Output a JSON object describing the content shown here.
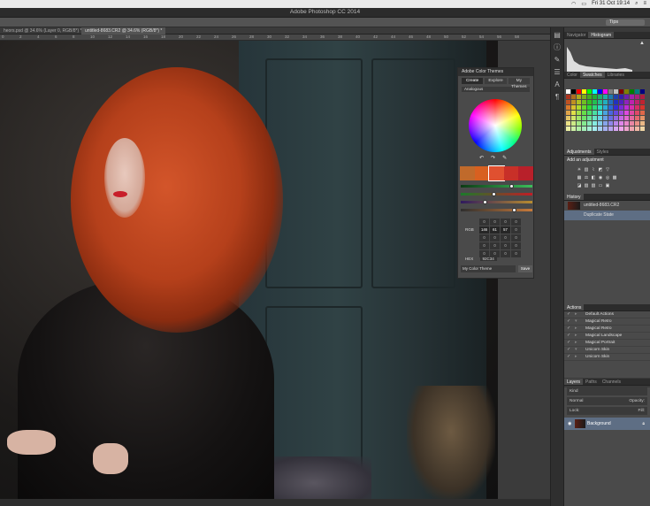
{
  "mac_bar": {
    "clock": "Fri 31 Oct 19:14"
  },
  "window": {
    "title": "Adobe Photoshop CC 2014"
  },
  "options": {
    "workspace": "Tips"
  },
  "doc_tabs": [
    {
      "label": "heors.psd @ 34.6% (Layer 0, RGB/8*) *"
    },
    {
      "label": "untitled-8683.CR2 @ 34.6% (RGB/8*) *"
    }
  ],
  "ruler_ticks": [
    "0",
    "2",
    "4",
    "6",
    "8",
    "10",
    "12",
    "14",
    "16",
    "18",
    "20",
    "22",
    "24",
    "26",
    "28",
    "30",
    "32",
    "34",
    "36",
    "38",
    "40",
    "42",
    "44",
    "46",
    "48",
    "50",
    "52",
    "54",
    "56",
    "58"
  ],
  "panels": {
    "navigator": {
      "tabs": [
        "Navigator",
        "Histogram"
      ]
    },
    "swatches": {
      "tabs": [
        "Color",
        "Swatches",
        "Libraries"
      ]
    },
    "adjustments": {
      "tabs": [
        "Adjustments",
        "Styles"
      ],
      "hint": "Add an adjustment"
    },
    "history": {
      "tab": "History",
      "items": [
        {
          "label": "untitled-8683.CR2"
        },
        {
          "label": "Duplicate State"
        }
      ]
    },
    "actions": {
      "tab": "Actions",
      "items": [
        {
          "label": "Default Actions"
        },
        {
          "label": "Magical Retro"
        },
        {
          "label": "Magical Retro"
        },
        {
          "label": "Magical Landscape"
        },
        {
          "label": "Magical Portrait"
        },
        {
          "label": "Unicorn Skin"
        },
        {
          "label": "Unicorn Skin"
        }
      ]
    },
    "layers": {
      "tabs": [
        "Layers",
        "Paths",
        "Channels"
      ],
      "kind": "Kind",
      "blend": "Normal",
      "opacity_label": "Opacity:",
      "lock_label": "Lock:",
      "fill_label": "Fill:",
      "layer_name": "Background"
    }
  },
  "color_themes": {
    "title": "Adobe Color Themes",
    "tabs": [
      "Create",
      "Explore",
      "My Themes"
    ],
    "rule": "Analogous",
    "swatch_colors": [
      "#c06a2b",
      "#d86020",
      "#e05030",
      "#c83028",
      "#b8202a"
    ],
    "mode_label": "RGB",
    "values_row": [
      "146",
      "61",
      "57"
    ],
    "grid": [
      "0",
      "0",
      "0",
      "0",
      "146",
      "61",
      "57",
      "0",
      "0",
      "0",
      "0",
      "0",
      "0",
      "0",
      "0",
      "0",
      "0",
      "0",
      "0",
      "0"
    ],
    "hex_label": "HEX",
    "hex_value": "92C34",
    "theme_name": "My Color Theme",
    "save_label": "Save"
  }
}
